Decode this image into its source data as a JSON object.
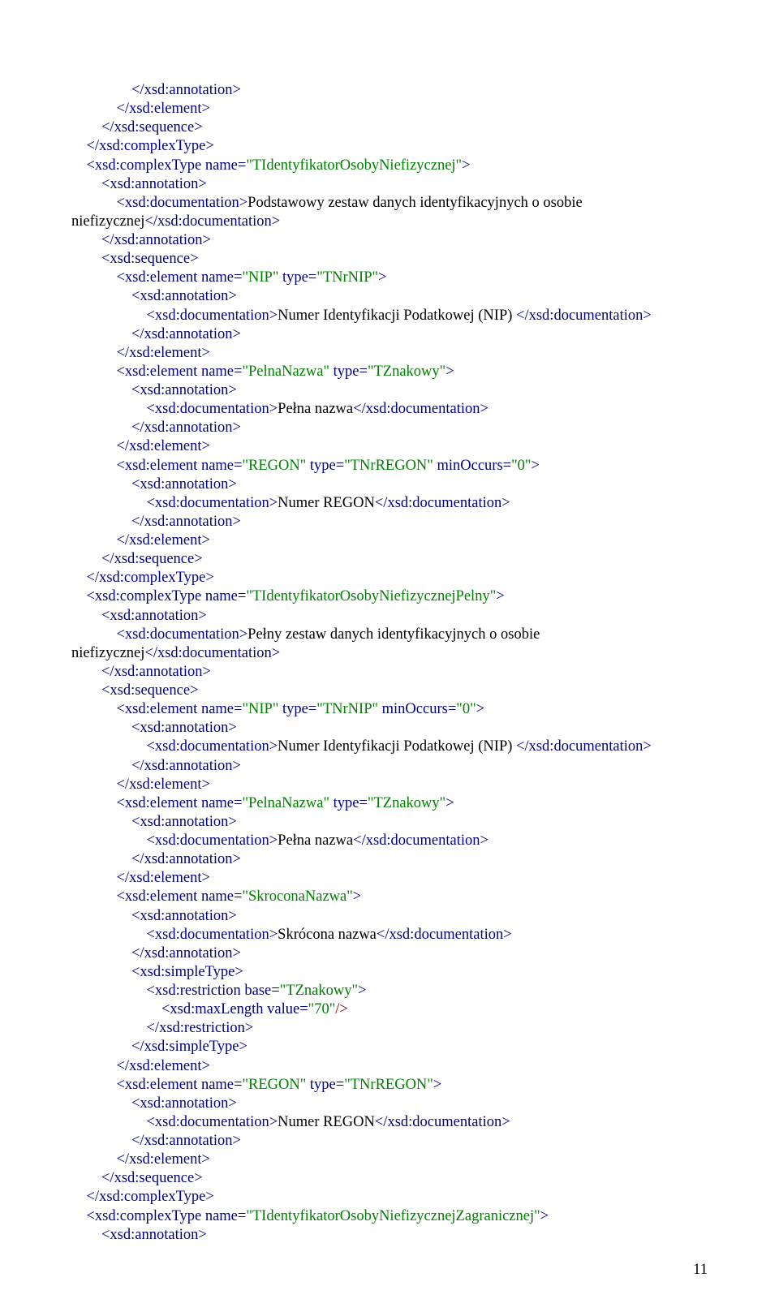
{
  "page_number": "11",
  "lines": [
    {
      "indent": 2,
      "segs": [
        {
          "c": "navy",
          "t": "</xsd:annotation>"
        }
      ]
    },
    {
      "indent": 1,
      "segs": [
        {
          "c": "navy",
          "t": "</xsd:element>"
        }
      ]
    },
    {
      "indent": 0,
      "segs": [
        {
          "c": "navy",
          "t": "</xsd:sequence>"
        }
      ]
    },
    {
      "indent": -1,
      "segs": [
        {
          "c": "navy",
          "t": "</xsd:complexType>"
        }
      ]
    },
    {
      "indent": -1,
      "segs": [
        {
          "c": "navy",
          "t": "<xsd:complexType name="
        },
        {
          "c": "green",
          "t": "\"TIdentyfikatorOsobyNiefizycznej\""
        },
        {
          "c": "navy",
          "t": ">"
        }
      ]
    },
    {
      "indent": 0,
      "segs": [
        {
          "c": "navy",
          "t": "<xsd:annotation>"
        }
      ]
    },
    {
      "indent": 1,
      "segs": [
        {
          "c": "navy",
          "t": "<xsd:documentation>"
        },
        {
          "c": "black",
          "t": "Podstawowy zestaw danych identyfikacyjnych o osobie"
        }
      ]
    },
    {
      "indent": -2,
      "segs": [
        {
          "c": "black",
          "t": "niefizycznej"
        },
        {
          "c": "navy",
          "t": "</xsd:documentation>"
        }
      ]
    },
    {
      "indent": 0,
      "segs": [
        {
          "c": "navy",
          "t": "</xsd:annotation>"
        }
      ]
    },
    {
      "indent": 0,
      "segs": [
        {
          "c": "navy",
          "t": "<xsd:sequence>"
        }
      ]
    },
    {
      "indent": 1,
      "segs": [
        {
          "c": "navy",
          "t": "<xsd:element name="
        },
        {
          "c": "green",
          "t": "\"NIP\""
        },
        {
          "c": "navy",
          "t": " type="
        },
        {
          "c": "green",
          "t": "\"TNrNIP\""
        },
        {
          "c": "navy",
          "t": ">"
        }
      ]
    },
    {
      "indent": 2,
      "segs": [
        {
          "c": "navy",
          "t": "<xsd:annotation>"
        }
      ]
    },
    {
      "indent": 3,
      "segs": [
        {
          "c": "navy",
          "t": "<xsd:documentation>"
        },
        {
          "c": "black",
          "t": "Numer Identyfikacji Podatkowej (NIP) "
        },
        {
          "c": "navy",
          "t": "</xsd:documentation>"
        }
      ]
    },
    {
      "indent": 2,
      "segs": [
        {
          "c": "navy",
          "t": "</xsd:annotation>"
        }
      ]
    },
    {
      "indent": 1,
      "segs": [
        {
          "c": "navy",
          "t": "</xsd:element>"
        }
      ]
    },
    {
      "indent": 1,
      "segs": [
        {
          "c": "navy",
          "t": "<xsd:element name="
        },
        {
          "c": "green",
          "t": "\"PelnaNazwa\""
        },
        {
          "c": "navy",
          "t": " type="
        },
        {
          "c": "green",
          "t": "\"TZnakowy\""
        },
        {
          "c": "navy",
          "t": ">"
        }
      ]
    },
    {
      "indent": 2,
      "segs": [
        {
          "c": "navy",
          "t": "<xsd:annotation>"
        }
      ]
    },
    {
      "indent": 3,
      "segs": [
        {
          "c": "navy",
          "t": "<xsd:documentation>"
        },
        {
          "c": "black",
          "t": "Pełna nazwa"
        },
        {
          "c": "navy",
          "t": "</xsd:documentation>"
        }
      ]
    },
    {
      "indent": 2,
      "segs": [
        {
          "c": "navy",
          "t": "</xsd:annotation>"
        }
      ]
    },
    {
      "indent": 1,
      "segs": [
        {
          "c": "navy",
          "t": "</xsd:element>"
        }
      ]
    },
    {
      "indent": 1,
      "segs": [
        {
          "c": "navy",
          "t": "<xsd:element name="
        },
        {
          "c": "green",
          "t": "\"REGON\""
        },
        {
          "c": "navy",
          "t": " type="
        },
        {
          "c": "green",
          "t": "\"TNrREGON\""
        },
        {
          "c": "navy",
          "t": " minOccurs="
        },
        {
          "c": "green",
          "t": "\"0\""
        },
        {
          "c": "navy",
          "t": ">"
        }
      ]
    },
    {
      "indent": 2,
      "segs": [
        {
          "c": "navy",
          "t": "<xsd:annotation>"
        }
      ]
    },
    {
      "indent": 3,
      "segs": [
        {
          "c": "navy",
          "t": "<xsd:documentation>"
        },
        {
          "c": "black",
          "t": "Numer REGON"
        },
        {
          "c": "navy",
          "t": "</xsd:documentation>"
        }
      ]
    },
    {
      "indent": 2,
      "segs": [
        {
          "c": "navy",
          "t": "</xsd:annotation>"
        }
      ]
    },
    {
      "indent": 1,
      "segs": [
        {
          "c": "navy",
          "t": "</xsd:element>"
        }
      ]
    },
    {
      "indent": 0,
      "segs": [
        {
          "c": "navy",
          "t": "</xsd:sequence>"
        }
      ]
    },
    {
      "indent": -1,
      "segs": [
        {
          "c": "navy",
          "t": "</xsd:complexType>"
        }
      ]
    },
    {
      "indent": -1,
      "segs": [
        {
          "c": "navy",
          "t": "<xsd:complexType name="
        },
        {
          "c": "green",
          "t": "\"TIdentyfikatorOsobyNiefizycznejPelny\""
        },
        {
          "c": "navy",
          "t": ">"
        }
      ]
    },
    {
      "indent": 0,
      "segs": [
        {
          "c": "navy",
          "t": "<xsd:annotation>"
        }
      ]
    },
    {
      "indent": 1,
      "segs": [
        {
          "c": "navy",
          "t": "<xsd:documentation>"
        },
        {
          "c": "black",
          "t": "Pełny zestaw danych identyfikacyjnych o osobie"
        }
      ]
    },
    {
      "indent": -2,
      "segs": [
        {
          "c": "black",
          "t": "niefizycznej"
        },
        {
          "c": "navy",
          "t": "</xsd:documentation>"
        }
      ]
    },
    {
      "indent": 0,
      "segs": [
        {
          "c": "navy",
          "t": "</xsd:annotation>"
        }
      ]
    },
    {
      "indent": 0,
      "segs": [
        {
          "c": "navy",
          "t": "<xsd:sequence>"
        }
      ]
    },
    {
      "indent": 1,
      "segs": [
        {
          "c": "navy",
          "t": "<xsd:element name="
        },
        {
          "c": "green",
          "t": "\"NIP\""
        },
        {
          "c": "navy",
          "t": " type="
        },
        {
          "c": "green",
          "t": "\"TNrNIP\""
        },
        {
          "c": "navy",
          "t": " minOccurs="
        },
        {
          "c": "green",
          "t": "\"0\""
        },
        {
          "c": "navy",
          "t": ">"
        }
      ]
    },
    {
      "indent": 2,
      "segs": [
        {
          "c": "navy",
          "t": "<xsd:annotation>"
        }
      ]
    },
    {
      "indent": 3,
      "segs": [
        {
          "c": "navy",
          "t": "<xsd:documentation>"
        },
        {
          "c": "black",
          "t": "Numer Identyfikacji Podatkowej (NIP) "
        },
        {
          "c": "navy",
          "t": "</xsd:documentation>"
        }
      ]
    },
    {
      "indent": 2,
      "segs": [
        {
          "c": "navy",
          "t": "</xsd:annotation>"
        }
      ]
    },
    {
      "indent": 1,
      "segs": [
        {
          "c": "navy",
          "t": "</xsd:element>"
        }
      ]
    },
    {
      "indent": 1,
      "segs": [
        {
          "c": "navy",
          "t": "<xsd:element name="
        },
        {
          "c": "green",
          "t": "\"PelnaNazwa\""
        },
        {
          "c": "navy",
          "t": " type="
        },
        {
          "c": "green",
          "t": "\"TZnakowy\""
        },
        {
          "c": "navy",
          "t": ">"
        }
      ]
    },
    {
      "indent": 2,
      "segs": [
        {
          "c": "navy",
          "t": "<xsd:annotation>"
        }
      ]
    },
    {
      "indent": 3,
      "segs": [
        {
          "c": "navy",
          "t": "<xsd:documentation>"
        },
        {
          "c": "black",
          "t": "Pełna nazwa"
        },
        {
          "c": "navy",
          "t": "</xsd:documentation>"
        }
      ]
    },
    {
      "indent": 2,
      "segs": [
        {
          "c": "navy",
          "t": "</xsd:annotation>"
        }
      ]
    },
    {
      "indent": 1,
      "segs": [
        {
          "c": "navy",
          "t": "</xsd:element>"
        }
      ]
    },
    {
      "indent": 1,
      "segs": [
        {
          "c": "navy",
          "t": "<xsd:element name="
        },
        {
          "c": "green",
          "t": "\"SkroconaNazwa\""
        },
        {
          "c": "navy",
          "t": ">"
        }
      ]
    },
    {
      "indent": 2,
      "segs": [
        {
          "c": "navy",
          "t": "<xsd:annotation>"
        }
      ]
    },
    {
      "indent": 3,
      "segs": [
        {
          "c": "navy",
          "t": "<xsd:documentation>"
        },
        {
          "c": "black",
          "t": "Skrócona nazwa"
        },
        {
          "c": "navy",
          "t": "</xsd:documentation>"
        }
      ]
    },
    {
      "indent": 2,
      "segs": [
        {
          "c": "navy",
          "t": "</xsd:annotation>"
        }
      ]
    },
    {
      "indent": 2,
      "segs": [
        {
          "c": "navy",
          "t": "<xsd:simpleType>"
        }
      ]
    },
    {
      "indent": 3,
      "segs": [
        {
          "c": "navy",
          "t": "<xsd:restriction base="
        },
        {
          "c": "green",
          "t": "\"TZnakowy\""
        },
        {
          "c": "navy",
          "t": ">"
        }
      ]
    },
    {
      "indent": 4,
      "segs": [
        {
          "c": "navy",
          "t": "<xsd:maxLength value="
        },
        {
          "c": "green",
          "t": "\"70\""
        },
        {
          "c": "maroon",
          "t": "/>"
        }
      ]
    },
    {
      "indent": 3,
      "segs": [
        {
          "c": "navy",
          "t": "</xsd:restriction>"
        }
      ]
    },
    {
      "indent": 2,
      "segs": [
        {
          "c": "navy",
          "t": "</xsd:simpleType>"
        }
      ]
    },
    {
      "indent": 1,
      "segs": [
        {
          "c": "navy",
          "t": "</xsd:element>"
        }
      ]
    },
    {
      "indent": 1,
      "segs": [
        {
          "c": "navy",
          "t": "<xsd:element name="
        },
        {
          "c": "green",
          "t": "\"REGON\""
        },
        {
          "c": "navy",
          "t": " type="
        },
        {
          "c": "green",
          "t": "\"TNrREGON\""
        },
        {
          "c": "navy",
          "t": ">"
        }
      ]
    },
    {
      "indent": 2,
      "segs": [
        {
          "c": "navy",
          "t": "<xsd:annotation>"
        }
      ]
    },
    {
      "indent": 3,
      "segs": [
        {
          "c": "navy",
          "t": "<xsd:documentation>"
        },
        {
          "c": "black",
          "t": "Numer REGON"
        },
        {
          "c": "navy",
          "t": "</xsd:documentation>"
        }
      ]
    },
    {
      "indent": 2,
      "segs": [
        {
          "c": "navy",
          "t": "</xsd:annotation>"
        }
      ]
    },
    {
      "indent": 1,
      "segs": [
        {
          "c": "navy",
          "t": "</xsd:element>"
        }
      ]
    },
    {
      "indent": 0,
      "segs": [
        {
          "c": "navy",
          "t": "</xsd:sequence>"
        }
      ]
    },
    {
      "indent": -1,
      "segs": [
        {
          "c": "navy",
          "t": "</xsd:complexType>"
        }
      ]
    },
    {
      "indent": -1,
      "segs": [
        {
          "c": "navy",
          "t": "<xsd:complexType name="
        },
        {
          "c": "green",
          "t": "\"TIdentyfikatorOsobyNiefizycznejZagranicznej\""
        },
        {
          "c": "navy",
          "t": ">"
        }
      ]
    },
    {
      "indent": 0,
      "segs": [
        {
          "c": "navy",
          "t": "<xsd:annotation>"
        }
      ]
    }
  ]
}
